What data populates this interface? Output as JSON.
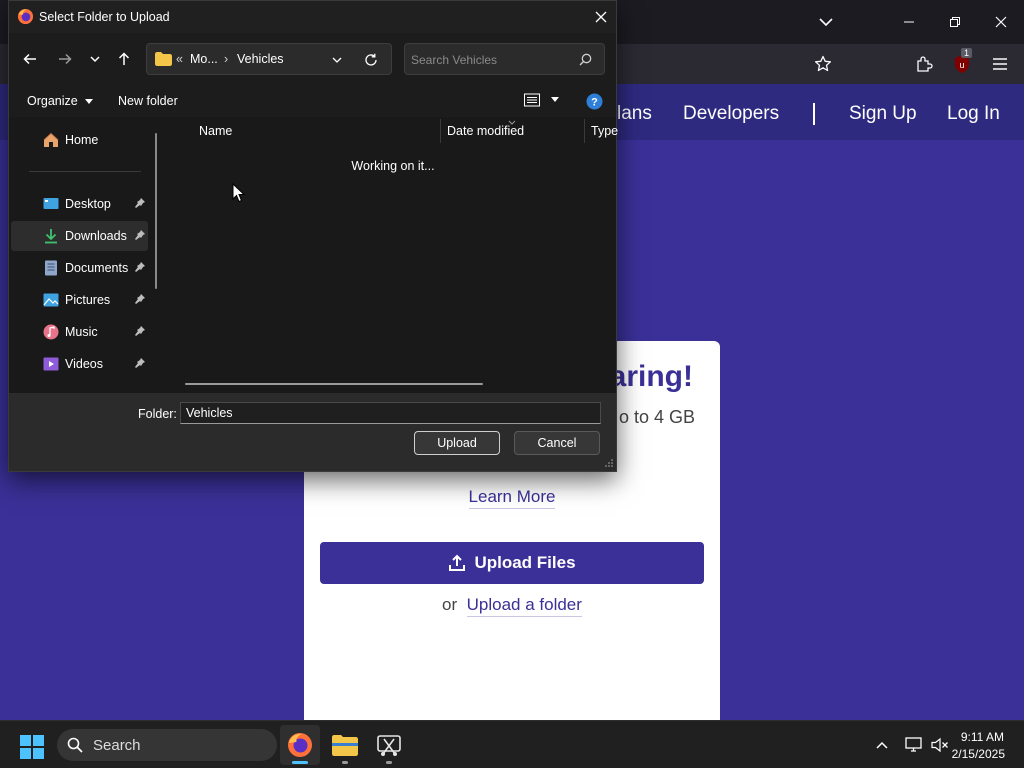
{
  "dialog": {
    "title": "Select Folder to Upload",
    "breadcrumb": {
      "overflow": "«",
      "parent": "Mo...",
      "separator": "›",
      "current": "Vehicles"
    },
    "search_placeholder": "Search Vehicles",
    "commands": {
      "organize": "Organize",
      "new_folder": "New folder"
    },
    "nav_pane": {
      "items": [
        {
          "label": "Home",
          "icon": "home-icon",
          "pinned": false
        },
        {
          "label": "Desktop",
          "icon": "desktop-icon",
          "pinned": true
        },
        {
          "label": "Downloads",
          "icon": "download-icon",
          "pinned": true,
          "selected": true
        },
        {
          "label": "Documents",
          "icon": "documents-icon",
          "pinned": true
        },
        {
          "label": "Pictures",
          "icon": "pictures-icon",
          "pinned": true
        },
        {
          "label": "Music",
          "icon": "music-icon",
          "pinned": true
        },
        {
          "label": "Videos",
          "icon": "videos-icon",
          "pinned": true
        }
      ]
    },
    "columns": [
      "Name",
      "Date modified",
      "Type"
    ],
    "status": "Working on it...",
    "folder_label": "Folder:",
    "folder_value": "Vehicles",
    "buttons": {
      "upload": "Upload",
      "cancel": "Cancel"
    }
  },
  "site": {
    "nav": {
      "plans_partial": "lans",
      "developers": "Developers",
      "sign_up": "Sign Up",
      "log_in": "Log In"
    },
    "card": {
      "heading_partial": "aring!",
      "subtext_partial": "o to 4 GB",
      "learn_more": "Learn More",
      "upload_files": "Upload Files",
      "or": "or",
      "upload_folder": "Upload a folder"
    },
    "colors": {
      "brand": "#3a3097",
      "nav": "#2e2a80"
    }
  },
  "browser": {
    "extension_badge": "1"
  },
  "taskbar": {
    "search_label": "Search",
    "apps": [
      "firefox-icon",
      "file-explorer-icon",
      "snipping-tool-icon"
    ],
    "time": "9:11 AM",
    "date": "2/15/2025"
  }
}
